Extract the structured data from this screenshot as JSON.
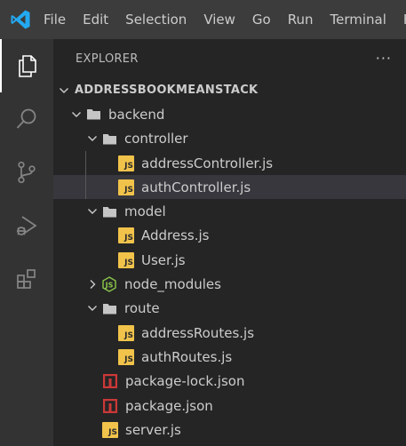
{
  "menu": {
    "items": [
      "File",
      "Edit",
      "Selection",
      "View",
      "Go",
      "Run",
      "Terminal",
      "H"
    ]
  },
  "activity_bar": {
    "icons": [
      "explorer-icon",
      "search-icon",
      "source-control-icon",
      "run-debug-icon",
      "extensions-icon"
    ]
  },
  "explorer": {
    "title": "EXPLORER",
    "more_label": "···",
    "root": "ADDRESSBOOKMEANSTACK",
    "items": [
      {
        "label": "backend",
        "kind": "folder",
        "depth": 1,
        "expanded": true
      },
      {
        "label": "controller",
        "kind": "folder",
        "depth": 2,
        "expanded": true
      },
      {
        "label": "addressController.js",
        "kind": "js",
        "depth": 3
      },
      {
        "label": "authController.js",
        "kind": "js",
        "depth": 3,
        "selected": true
      },
      {
        "label": "model",
        "kind": "folder",
        "depth": 2,
        "expanded": true
      },
      {
        "label": "Address.js",
        "kind": "js",
        "depth": 3
      },
      {
        "label": "User.js",
        "kind": "js",
        "depth": 3
      },
      {
        "label": "node_modules",
        "kind": "node",
        "depth": 2,
        "expanded": false
      },
      {
        "label": "route",
        "kind": "folder",
        "depth": 2,
        "expanded": true
      },
      {
        "label": "addressRoutes.js",
        "kind": "js",
        "depth": 3
      },
      {
        "label": "authRoutes.js",
        "kind": "js",
        "depth": 3
      },
      {
        "label": "package-lock.json",
        "kind": "npm",
        "depth": 2
      },
      {
        "label": "package.json",
        "kind": "npm",
        "depth": 2
      },
      {
        "label": "server.js",
        "kind": "js",
        "depth": 2
      }
    ]
  },
  "colors": {
    "title_bar": "#3c3c3c",
    "activity_bar": "#333333",
    "sidebar": "#252526",
    "selected_row": "#37373d",
    "js_badge": "#f1c34b",
    "npm_icon": "#cb3837",
    "node_icon": "#8cc84b",
    "vscode_blue": "#23a9f2"
  }
}
